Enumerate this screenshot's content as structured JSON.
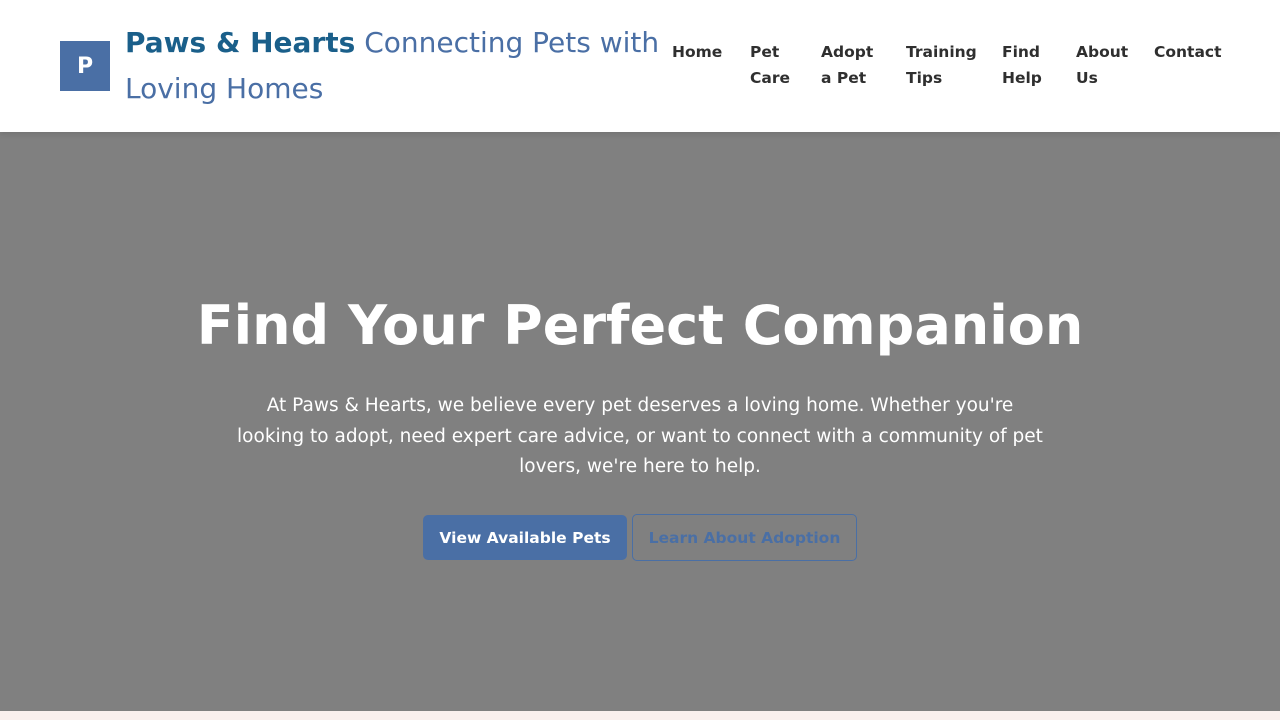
{
  "header": {
    "logo_letter": "P",
    "brand_name": "Paws & Hearts",
    "tagline": " Connecting Pets with Loving Homes"
  },
  "nav": {
    "items": [
      {
        "label": "Home"
      },
      {
        "label": "Pet Care"
      },
      {
        "label": "Adopt a Pet"
      },
      {
        "label": "Training Tips"
      },
      {
        "label": "Find Help"
      },
      {
        "label": "About Us"
      },
      {
        "label": "Contact"
      }
    ]
  },
  "hero": {
    "title": "Find Your Perfect Companion",
    "text": "At Paws & Hearts, we believe every pet deserves a loving home. Whether you're looking to adopt, need expert care advice, or want to connect with a community of pet lovers, we're here to help.",
    "primary_button": "View Available Pets",
    "secondary_button": "Learn About Adoption"
  },
  "colors": {
    "primary": "#4a6fa5",
    "brand_dark": "#1a5f8a",
    "hero_overlay": "#808080",
    "header_bg": "#ffffff"
  }
}
